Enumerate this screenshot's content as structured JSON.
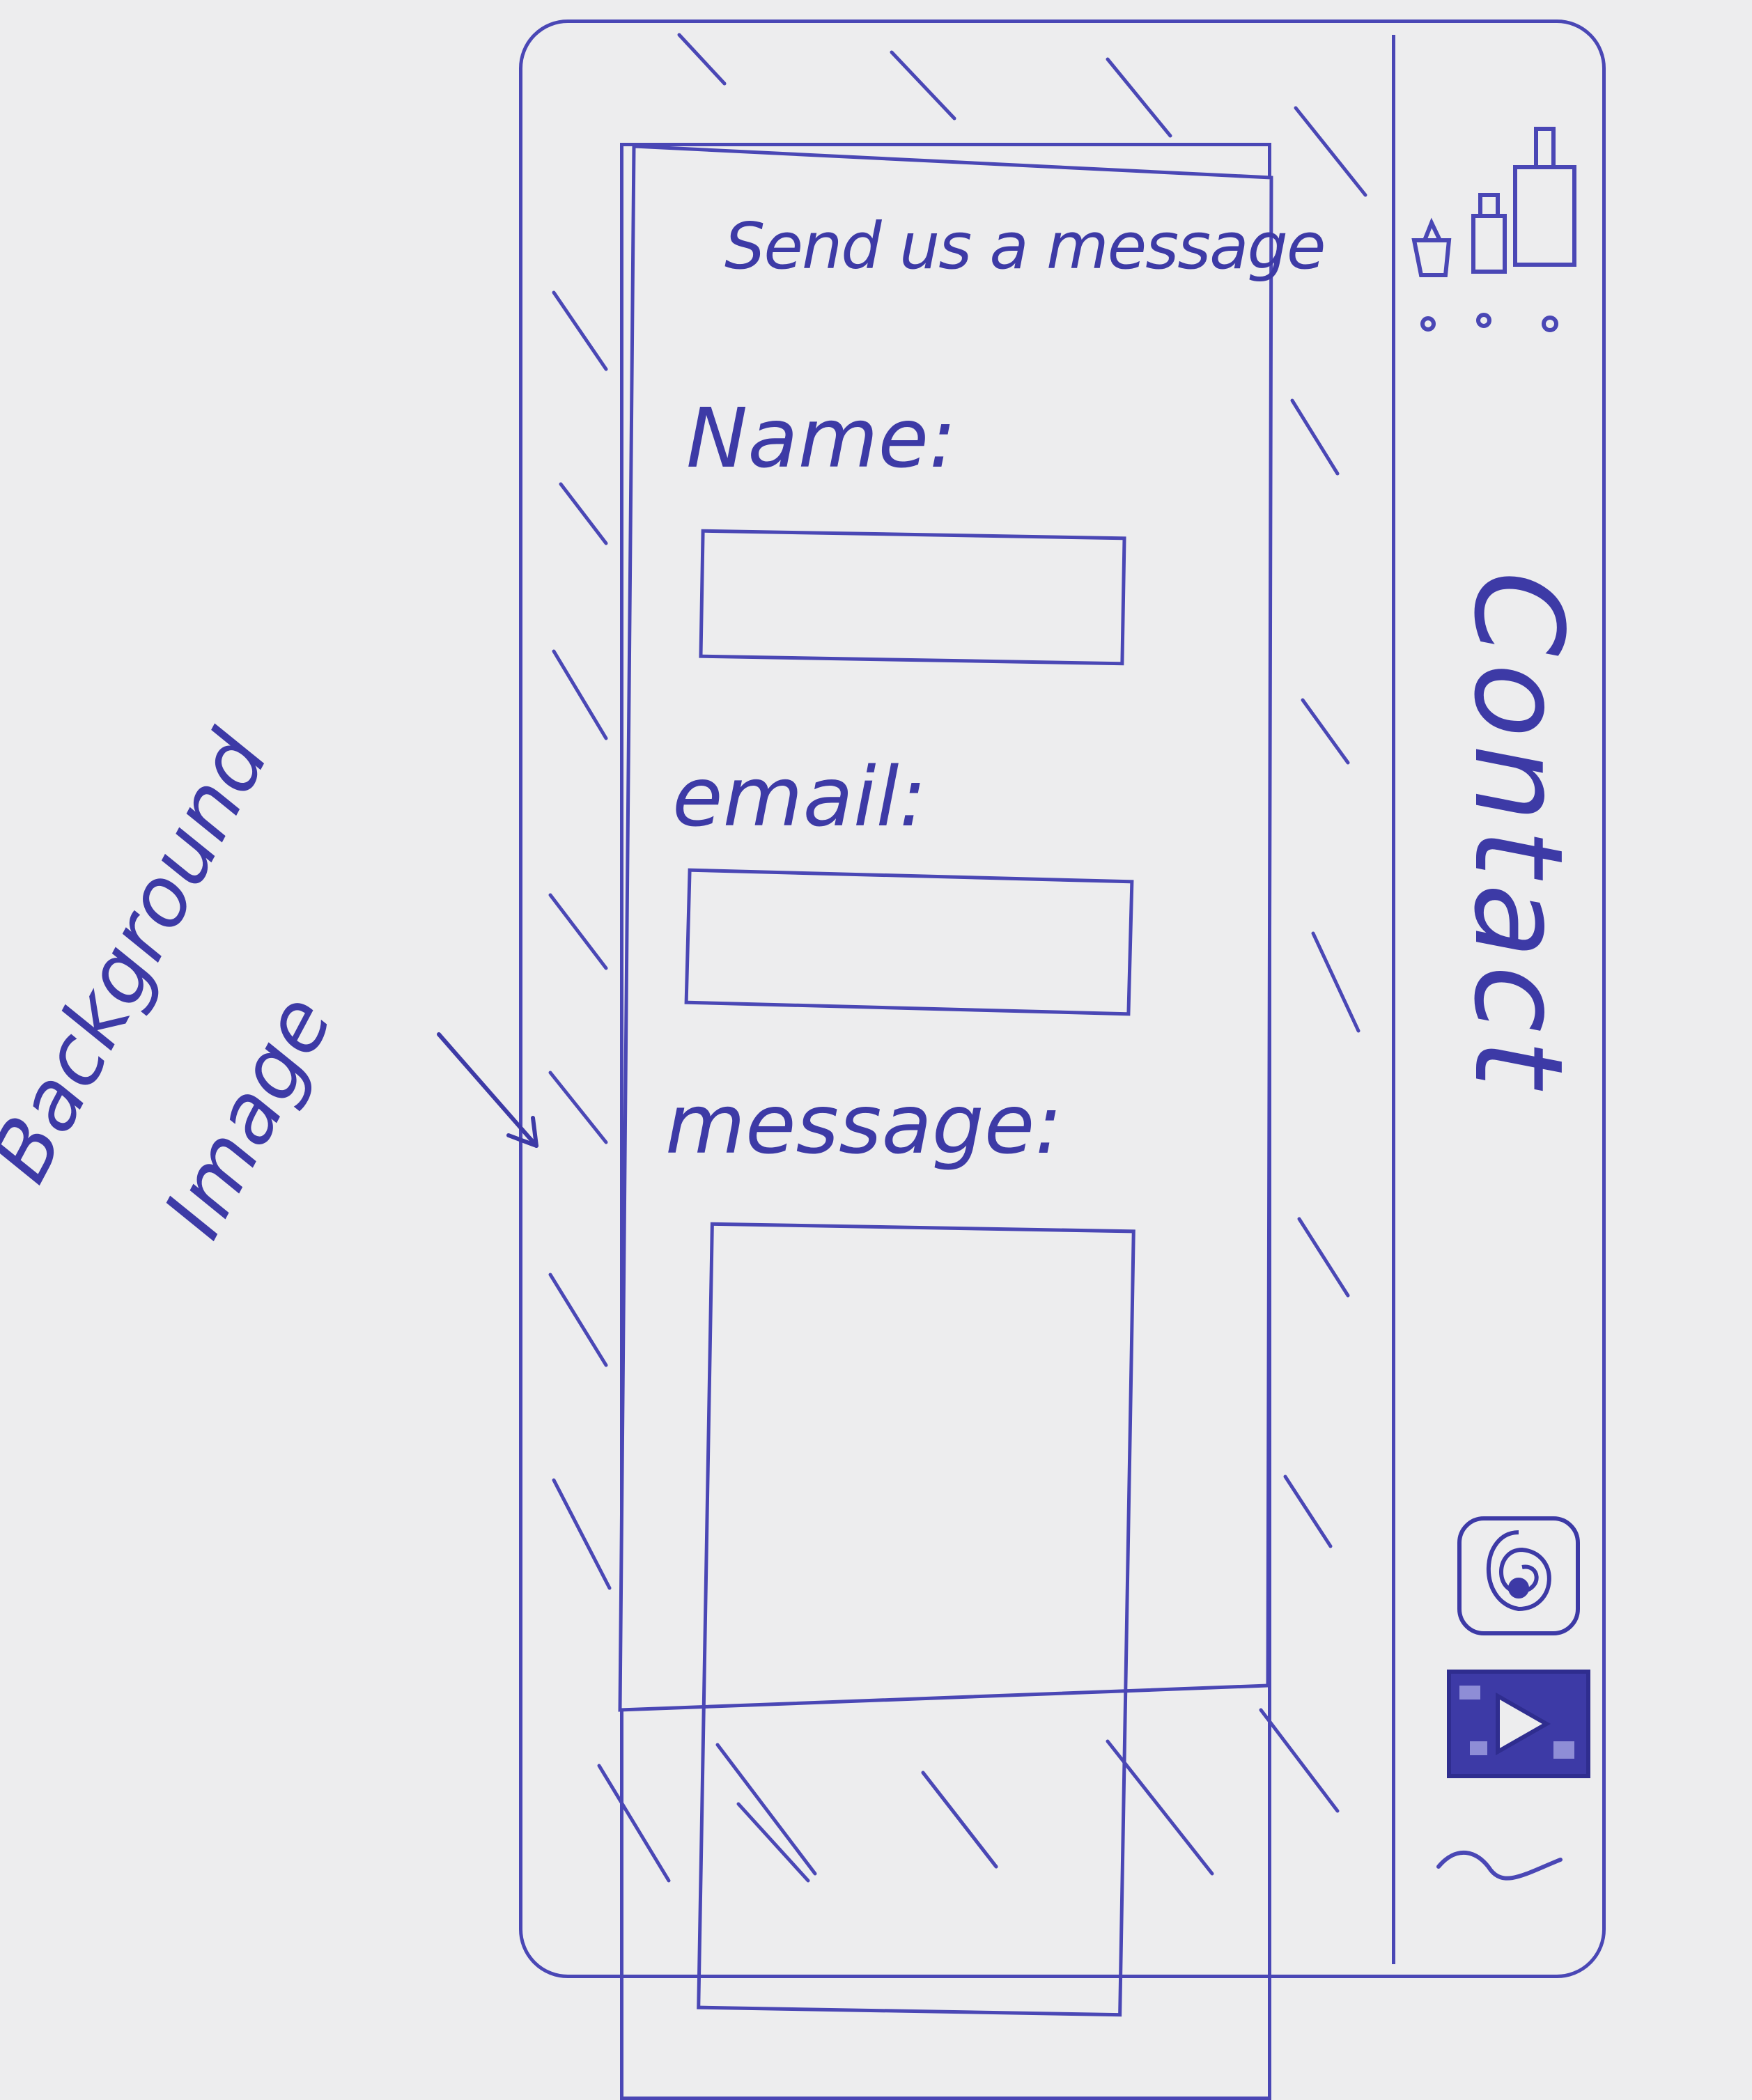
{
  "form": {
    "title": "Send us a message",
    "name_label": "Name:",
    "email_label": "email:",
    "message_label": "message:"
  },
  "sidebar": {
    "heading": "Contact",
    "icons": [
      "people-group-icon",
      "instagram-icon",
      "youtube-icon",
      "wave-icon"
    ]
  },
  "annotations": {
    "background_line1": "Background",
    "background_line2": "Image"
  },
  "colors": {
    "ink": "#4a47b5",
    "paper": "#ededee"
  }
}
